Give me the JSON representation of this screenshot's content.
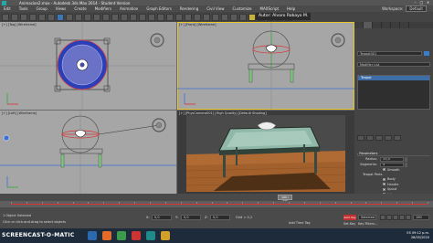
{
  "titlebar": {
    "title": "Animacion2.max - Autodesk 3ds Max 2014 - Student Version",
    "minimize": "–",
    "maximize": "□",
    "close": "✕"
  },
  "menu": {
    "items": [
      "Edit",
      "Tools",
      "Group",
      "Views",
      "Create",
      "Modifiers",
      "Animation",
      "Graph Editors",
      "Rendering",
      "Civil View",
      "Customize",
      "MAXScript",
      "Help"
    ],
    "workspace_label": "Workspace:",
    "workspace_value": "Default"
  },
  "author_badge": "Autor: Alvaro Robayo M.",
  "command_panel": {
    "object_name": "Teapot001",
    "modifier_list": "Modifier List",
    "stack_items": [
      "Teapot"
    ],
    "parameters_header": "- Parameters",
    "radius_label": "Radius:",
    "radius_value": "33,0",
    "segments_label": "Segments:",
    "segments_value": "4",
    "smooth_label": "Smooth",
    "teapot_parts_label": "Teapot Parts",
    "parts": [
      {
        "label": "Body",
        "checked": true
      },
      {
        "label": "Handle",
        "checked": true
      },
      {
        "label": "Spout",
        "checked": true
      },
      {
        "label": "Lid",
        "checked": true
      }
    ],
    "swatch_color": "#3a7ec8"
  },
  "viewports": {
    "top_label": "[+] [Top] [Wireframe]",
    "front_label": "[+] [Front] [Wireframe]",
    "left_label": "[+] [Left] [Wireframe]",
    "persp_label": "[+] [PhysCamera001] [High Quality] [Default Shading]"
  },
  "timeline": {
    "thumb_label": "190 / 270",
    "tick_labels": [
      "0",
      "10",
      "20",
      "30",
      "40",
      "50",
      "60",
      "70",
      "80",
      "90",
      "100",
      "110",
      "120",
      "130",
      "140",
      "150",
      "160",
      "170",
      "180",
      "190",
      "200",
      "210",
      "220",
      "230",
      "240",
      "250",
      "260",
      "270"
    ]
  },
  "status": {
    "line1": "1 Object Selected",
    "line2": "Click or click-and-drag to select objects",
    "x_label": "X:",
    "x_value": "0,0",
    "y_label": "Y:",
    "y_value": "0,0",
    "z_label": "Z:",
    "z_value": "0,0",
    "grid_label": "Grid = 0,1",
    "add_time_tag": "Add Time Tag",
    "auto_key": "Auto Key",
    "set_key": "Set Key",
    "selected": "Selected",
    "key_filters": "Key Filters...",
    "frame_value": "190"
  },
  "taskbar": {
    "watermark": "SCREENCAST-O-MATIC",
    "time": "09:12 p.m.",
    "date": "26/05/2020",
    "language": "ES"
  }
}
